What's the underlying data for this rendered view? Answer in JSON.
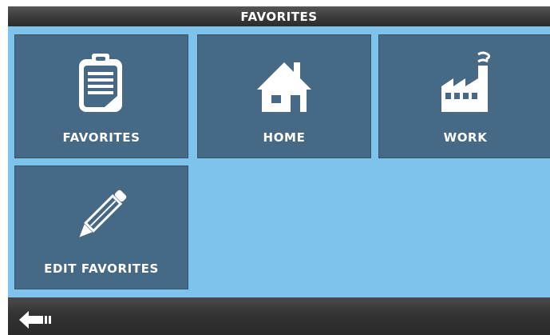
{
  "header": {
    "title": "FAVORITES"
  },
  "tiles": [
    {
      "label": "FAVORITES",
      "icon": "clipboard-icon"
    },
    {
      "label": "HOME",
      "icon": "house-icon"
    },
    {
      "label": "WORK",
      "icon": "factory-icon"
    },
    {
      "label": "EDIT FAVORITES",
      "icon": "pencil-icon"
    }
  ],
  "footer": {
    "back_icon": "back-arrow-icon"
  },
  "colors": {
    "background": "#7ec3ec",
    "tile": "#466a86",
    "bar": "#3a3a3a",
    "text": "#ffffff"
  }
}
